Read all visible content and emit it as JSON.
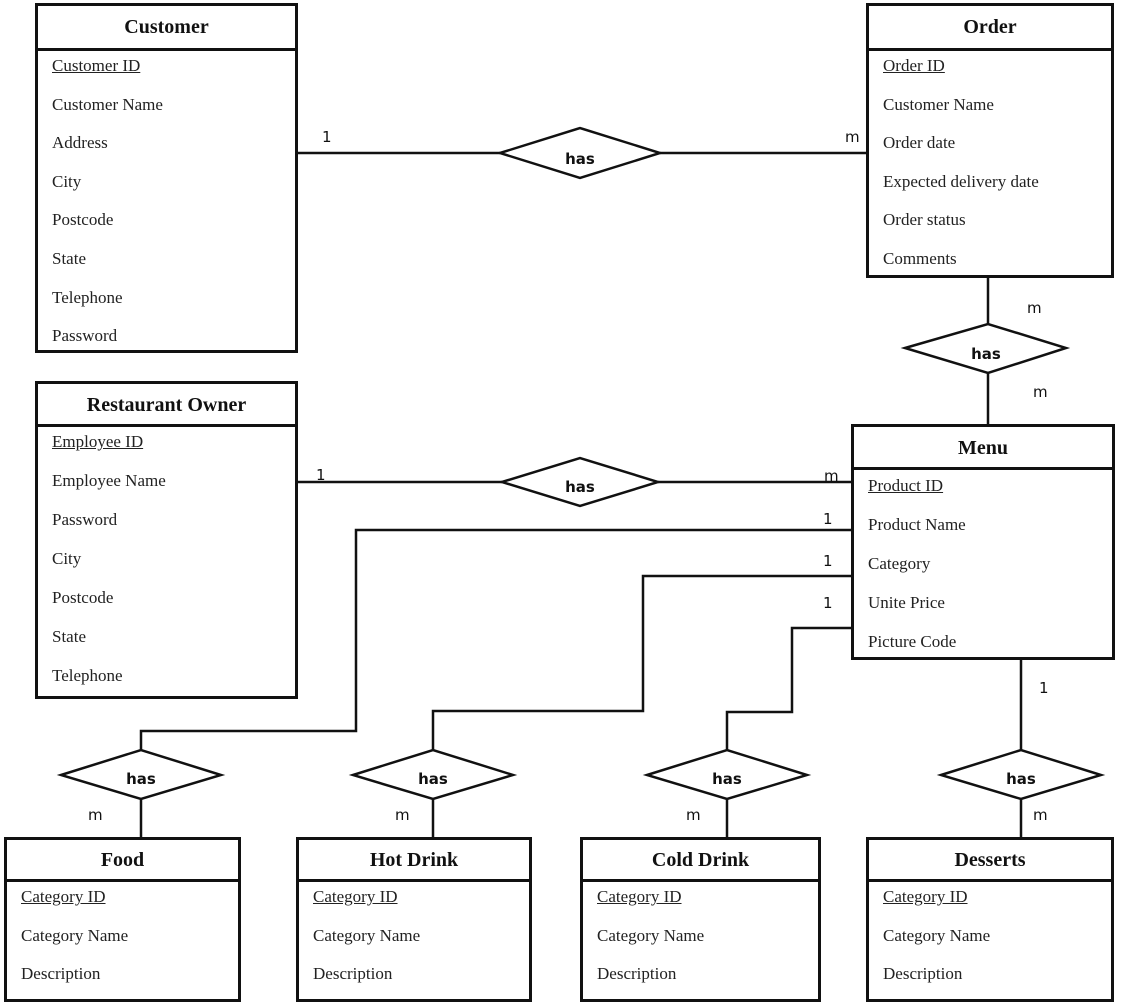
{
  "diagram": {
    "type": "entity-relationship",
    "entities": {
      "customer": {
        "name": "Customer",
        "attributes": [
          {
            "label": "Customer ID",
            "pk": true
          },
          {
            "label": "Customer Name"
          },
          {
            "label": "Address"
          },
          {
            "label": "City"
          },
          {
            "label": "Postcode"
          },
          {
            "label": "State"
          },
          {
            "label": "Telephone"
          },
          {
            "label": "Password"
          }
        ]
      },
      "order": {
        "name": "Order",
        "attributes": [
          {
            "label": "Order ID",
            "pk": true
          },
          {
            "label": "Customer Name"
          },
          {
            "label": "Order date"
          },
          {
            "label": "Expected delivery date"
          },
          {
            "label": "Order status"
          },
          {
            "label": "Comments"
          }
        ]
      },
      "restaurant_owner": {
        "name": "Restaurant Owner",
        "attributes": [
          {
            "label": "Employee ID",
            "pk": true
          },
          {
            "label": "Employee Name"
          },
          {
            "label": "Password"
          },
          {
            "label": "City"
          },
          {
            "label": "Postcode"
          },
          {
            "label": "State"
          },
          {
            "label": "Telephone"
          }
        ]
      },
      "menu": {
        "name": "Menu",
        "attributes": [
          {
            "label": "Product ID",
            "pk": true
          },
          {
            "label": "Product Name"
          },
          {
            "label": "Category"
          },
          {
            "label": "Unite Price"
          },
          {
            "label": "Picture Code"
          }
        ]
      },
      "food": {
        "name": "Food",
        "attributes": [
          {
            "label": "Category ID",
            "pk": true
          },
          {
            "label": "Category Name"
          },
          {
            "label": "Description"
          }
        ]
      },
      "hot_drink": {
        "name": "Hot Drink",
        "attributes": [
          {
            "label": "Category ID",
            "pk": true
          },
          {
            "label": "Category Name"
          },
          {
            "label": "Description"
          }
        ]
      },
      "cold_drink": {
        "name": "Cold Drink",
        "attributes": [
          {
            "label": "Category ID",
            "pk": true
          },
          {
            "label": "Category Name"
          },
          {
            "label": "Description"
          }
        ]
      },
      "desserts": {
        "name": "Desserts",
        "attributes": [
          {
            "label": "Category ID",
            "pk": true
          },
          {
            "label": "Category Name"
          },
          {
            "label": "Description"
          }
        ]
      }
    },
    "relationships": [
      {
        "id": "customer-order",
        "label": "has",
        "from": "Customer",
        "to": "Order",
        "from_card": "1",
        "to_card": "m"
      },
      {
        "id": "order-menu",
        "label": "has",
        "from": "Order",
        "to": "Menu",
        "from_card": "m",
        "to_card": "m"
      },
      {
        "id": "owner-menu",
        "label": "has",
        "from": "Restaurant Owner",
        "to": "Menu",
        "from_card": "1",
        "to_card": "m"
      },
      {
        "id": "menu-food",
        "label": "has",
        "from": "Menu",
        "to": "Food",
        "from_card": "1",
        "to_card": "m"
      },
      {
        "id": "menu-hotdrink",
        "label": "has",
        "from": "Menu",
        "to": "Hot Drink",
        "from_card": "1",
        "to_card": "m"
      },
      {
        "id": "menu-colddrink",
        "label": "has",
        "from": "Menu",
        "to": "Cold Drink",
        "from_card": "1",
        "to_card": "m"
      },
      {
        "id": "menu-desserts",
        "label": "has",
        "from": "Menu",
        "to": "Desserts",
        "from_card": "1",
        "to_card": "m"
      }
    ]
  }
}
